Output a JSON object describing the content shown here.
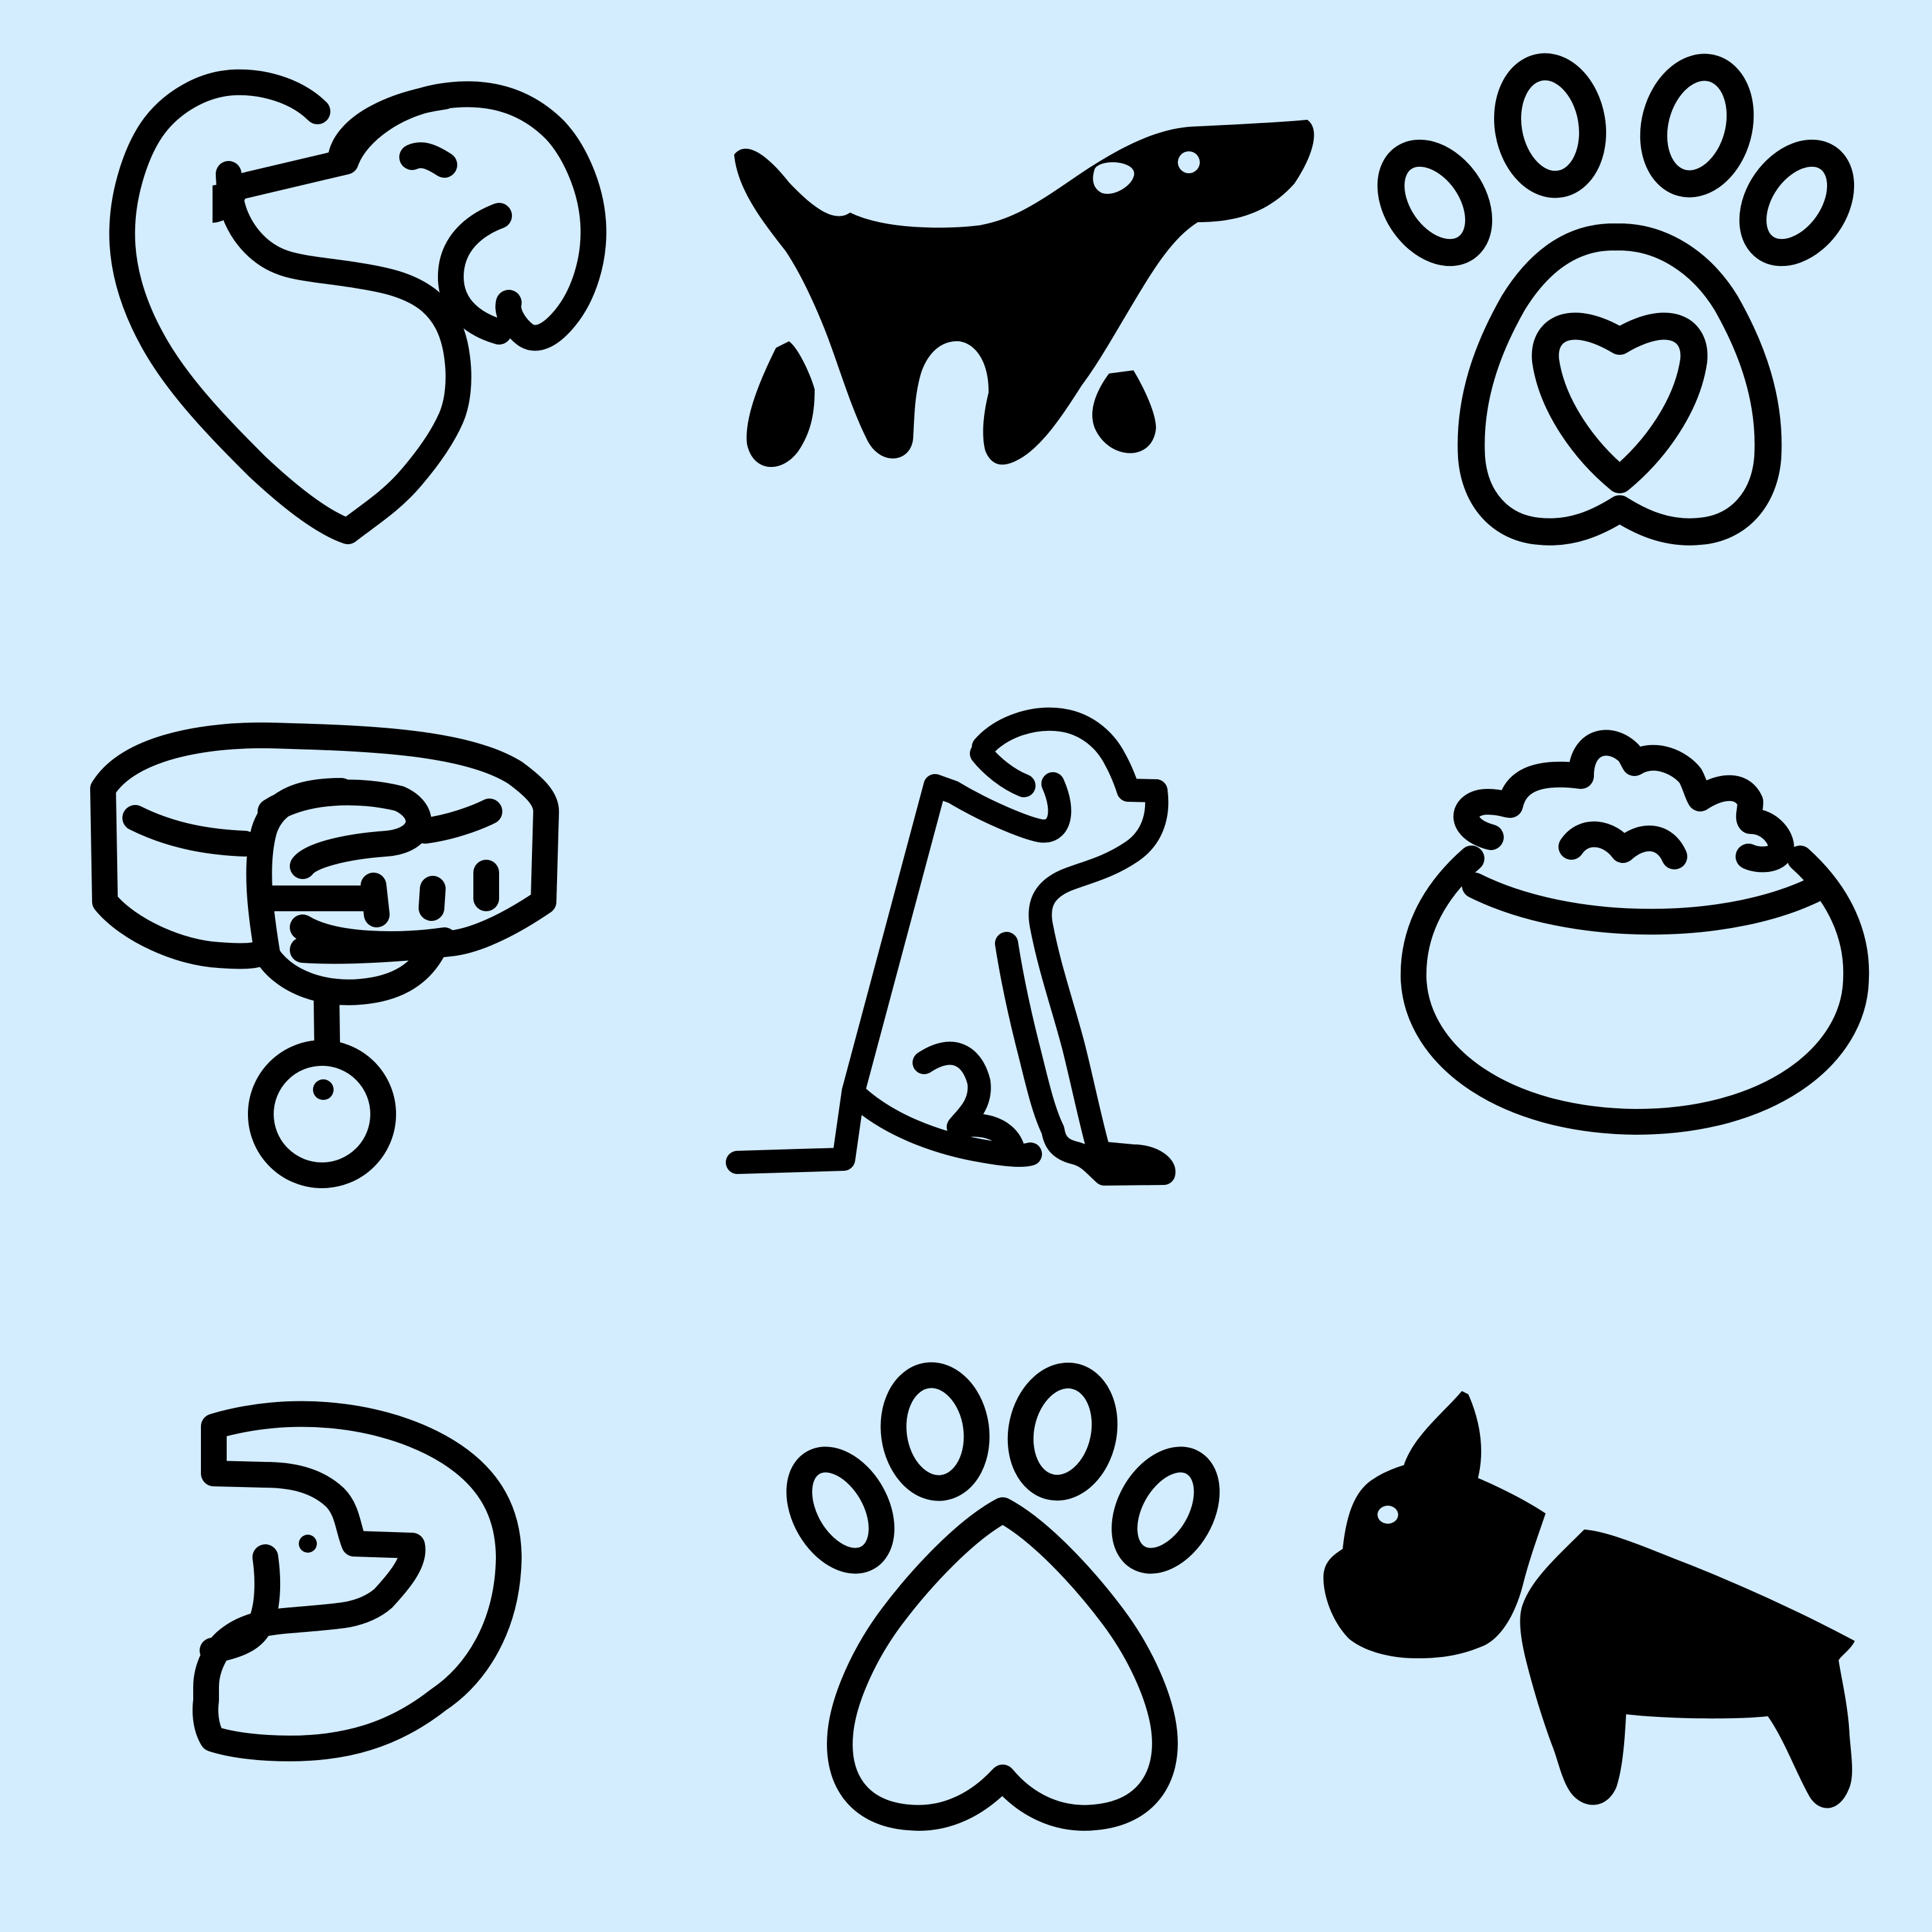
{
  "background": "#D3ECFE",
  "ink": "#000000",
  "icons": [
    {
      "name": "dog-heart-line-icon"
    },
    {
      "name": "dachshund-silhouette-icon"
    },
    {
      "name": "paw-heart-icon"
    },
    {
      "name": "dog-collar-tag-icon"
    },
    {
      "name": "sitting-dog-line-icon"
    },
    {
      "name": "food-bowl-icon"
    },
    {
      "name": "dog-face-circle-icon"
    },
    {
      "name": "paw-print-icon"
    },
    {
      "name": "french-bulldog-silhouette-icon"
    }
  ]
}
